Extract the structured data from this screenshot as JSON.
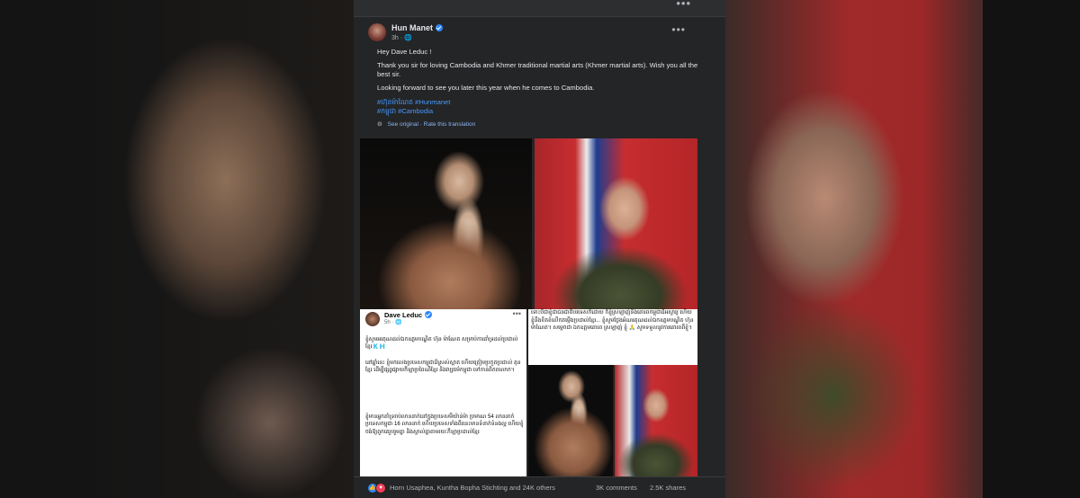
{
  "post": {
    "author": "Hun Manet",
    "time": "3h · ",
    "paragraphs": [
      "Hey Dave Leduc !",
      "Thank you sir for loving Cambodia and Khmer traditional martial arts (Khmer martial arts). Wish you all the best sir.",
      "Looking forward to see you later this year when he comes to Cambodia."
    ],
    "hashtags_line1": "#ហ៊ុនម៉ាណែត #Hunmanet",
    "hashtags_line2": "#កម្ពុជា #Cambodia",
    "see_original": "See original",
    "rate_translation": "Rate this translation",
    "more_icon": "•••"
  },
  "embed": {
    "author": "Dave Leduc",
    "time": "5h · ",
    "paragraphs": [
      "ខ្ញុំសូមអរគុណដល់ឯកឧត្តមបណ្ឌិត ហ៊ុន ម៉ាណែត សម្រាប់ការគាំទ្រដល់ប្រដាល់ខ្មែរ🇰🇭",
      "នៅឆ្នាំនេះ ខ្ញុំមកលេងប្រទេសកម្ពុជាដ៏ស្រស់ស្អាត ហើយត្រៀមប្រកួតប្រដាល់ គុនខ្មែរ ដើម្បីផ្សព្វផ្សាយកីឡាប្រពៃណីខ្មែរ និងវប្បធម៌កម្ពុជា ទៅកាន់ពិភពលោក។",
      "ខ្ញុំមានអ្នកគាំទ្ររាប់លាននាក់នៅក្នុងប្រទេសមីយ៉ាន់ម៉ា ប្រមាណ 54 លាននាក់ ប្រទេសកម្ពុជា 16 លាននាក់ ហើយប្រទេសទាំងពីរនេះមានទំនាក់ទំនងល្អ ហើយខ្ញុំចង់ឱ្យពួកគេរួបរួមគ្នា និងស្គាល់គ្នាតាមរយៈកីឡាប្រដាល់ខ្មែរ"
    ],
    "more_icon": "•••"
  },
  "right_caption": "ទោះបីជាខ្ញុំជាជនជាតិបរទេសក៏ដោយ ក៏ខ្ញុំស្រឡាញ់និងគោរពកម្ពុជាដ៏អស្ចារ្យ ហើយខ្ញុំនឹងខិតខំលើកតម្កើងប្រដាល់ខ្មែរ... ខ្ញុំសូមថ្លែងអំណរគុណដល់ឯកឧត្តមបណ្ឌិត ហ៊ុន ម៉ាណែត។ សម្ដេចជា ឯកឧត្តមគោរព ស្រឡាញ់ ខ្ញុំ 🙏 សូមទទួលនូវការគោរពពីខ្ញុំ។",
  "footer": {
    "reactors": "Horn Usaphea, Kuntha Bopha Stichting and 24K others",
    "comments": "3K comments",
    "shares": "2.5K shares"
  },
  "topbar": {
    "more_icon": "•••"
  },
  "colors": {
    "background": "#242526",
    "link": "#4599ff",
    "like": "#2d88ff",
    "love": "#f33e58"
  },
  "icons": [
    "verified-badge-icon",
    "globe-icon",
    "more-icon",
    "gear-icon",
    "like-reaction-icon",
    "love-reaction-icon"
  ]
}
